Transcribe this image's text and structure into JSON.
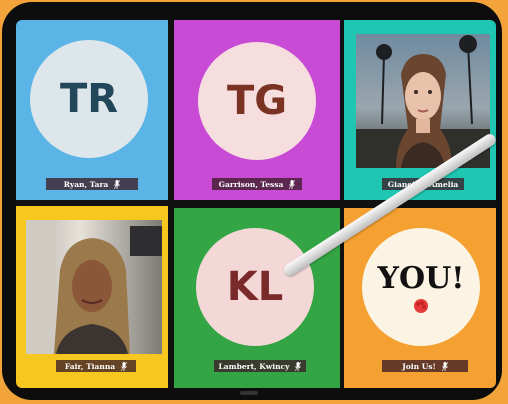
{
  "tiles": [
    {
      "name": "Ryan, Tara",
      "initials": "TR",
      "bg": "#5ab4e5",
      "circle": "#dde6ea",
      "initials_color": "#22475a",
      "type": "avatar"
    },
    {
      "name": "Garrison, Tessa",
      "initials": "TG",
      "bg": "#c84bd6",
      "circle": "#f6dede",
      "initials_color": "#7a3322",
      "type": "avatar"
    },
    {
      "name": "Gianetto, Amelia",
      "bg": "#1fc6b1",
      "type": "photo"
    },
    {
      "name": "Fair, Tianna",
      "bg": "#f6c71e",
      "type": "photo"
    },
    {
      "name": "Lambert, Kwincy",
      "initials": "KL",
      "bg": "#33a544",
      "circle": "#f4d8d8",
      "initials_color": "#7a2a2a",
      "type": "avatar"
    },
    {
      "name": "Join Us!",
      "initials": "YOU!",
      "bg": "#f5a131",
      "circle": "#fbf4e4",
      "initials_color": "#111111",
      "type": "you"
    }
  ],
  "colors": {
    "page_bg": "#f2a33a",
    "tablet": "#0d0d0d"
  },
  "icons": {
    "mic": "microphone-icon",
    "hand": "raised-fist-icon"
  }
}
